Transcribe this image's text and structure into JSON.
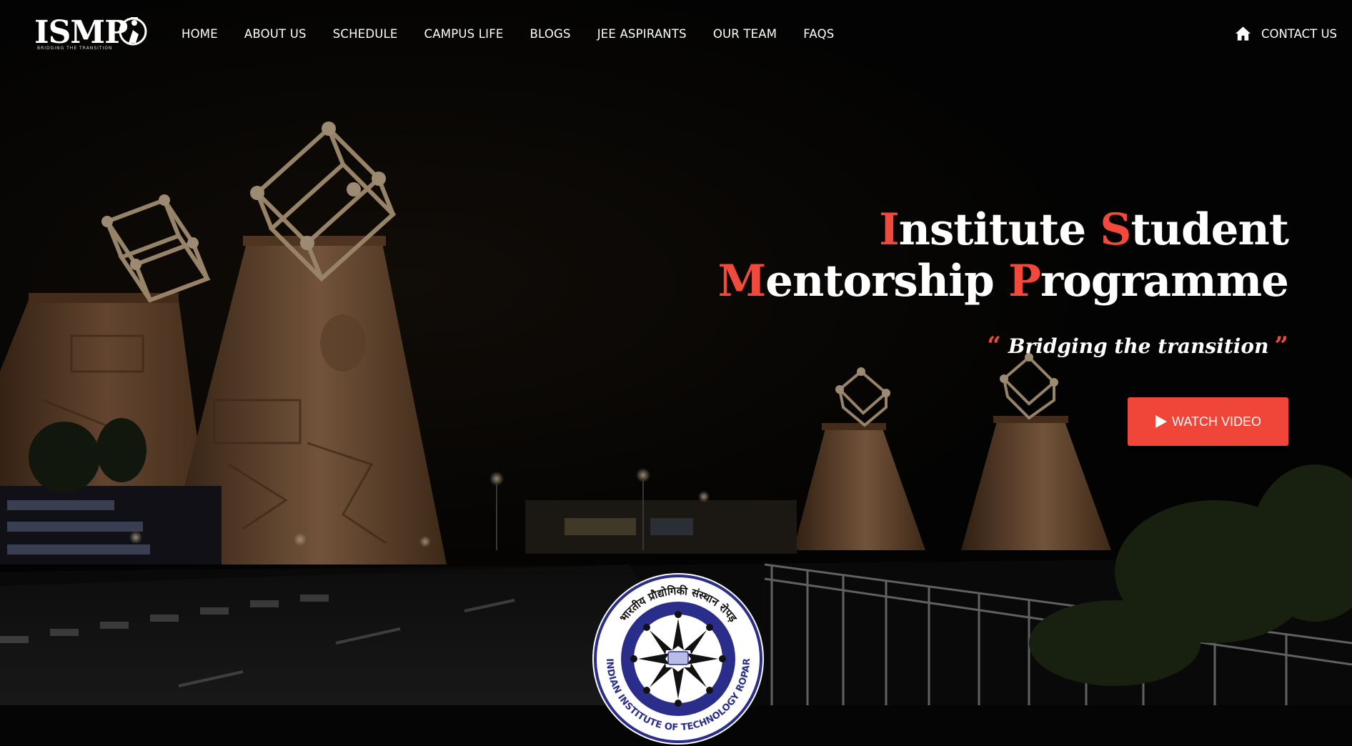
{
  "brand": {
    "logo_text": "ISMP",
    "logo_tagline": "BRIDGING THE TRANSITION"
  },
  "nav": {
    "items": [
      {
        "label": "HOME"
      },
      {
        "label": "ABOUT US"
      },
      {
        "label": "SCHEDULE"
      },
      {
        "label": "CAMPUS LIFE"
      },
      {
        "label": "BLOGS"
      },
      {
        "label": "JEE ASPIRANTS"
      },
      {
        "label": "OUR TEAM"
      },
      {
        "label": "FAQS"
      }
    ],
    "contact": {
      "label": "CONTACT US",
      "icon": "home-icon"
    }
  },
  "hero": {
    "title": {
      "line1": [
        {
          "initial": "I",
          "rest": "nstitute "
        },
        {
          "initial": "S",
          "rest": "tudent"
        }
      ],
      "line2": [
        {
          "initial": "M",
          "rest": "entorship "
        },
        {
          "initial": "P",
          "rest": "rogramme"
        }
      ]
    },
    "tagline": "Bridging the transition",
    "quote_open": "“",
    "quote_close": "”",
    "cta": {
      "label": "WATCH VIDEO",
      "icon": "play-icon"
    }
  },
  "emblem": {
    "top_text": "भारतीय प्रौद्योगिकी संस्थान रोपड़",
    "bottom_text": "INDIAN INSTITUTE OF TECHNOLOGY ROPAR"
  },
  "colors": {
    "accent": "#f14a3d",
    "button": "#f0463a",
    "background": "#050505",
    "text": "#ffffff",
    "emblem_blue": "#2b2d8a"
  }
}
